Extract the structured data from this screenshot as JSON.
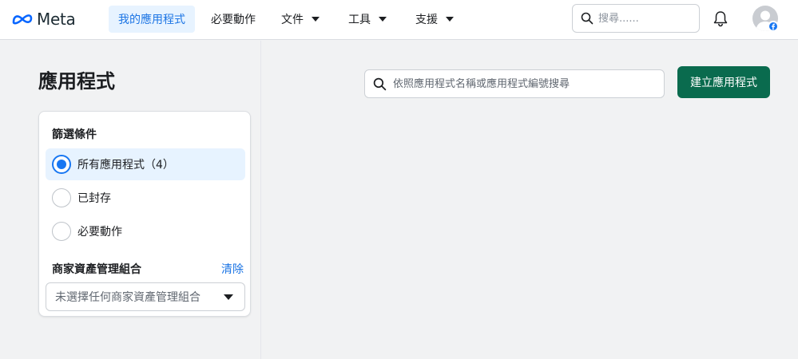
{
  "brand": {
    "name": "Meta",
    "color": "#0866ff"
  },
  "nav": {
    "items": [
      {
        "label": "我的應用程式",
        "active": true,
        "dropdown": false
      },
      {
        "label": "必要動作",
        "active": false,
        "dropdown": false
      },
      {
        "label": "文件",
        "active": false,
        "dropdown": true
      },
      {
        "label": "工具",
        "active": false,
        "dropdown": true
      },
      {
        "label": "支援",
        "active": false,
        "dropdown": true
      }
    ],
    "search_placeholder": "搜尋......",
    "icons": {
      "search": "search-icon",
      "notifications": "bell-icon",
      "profile": "avatar-icon",
      "badge": "facebook-icon"
    }
  },
  "page": {
    "title": "應用程式",
    "search_placeholder": "依照應用程式名稱或應用程式編號搜尋",
    "create_button": "建立應用程式",
    "accent_color": "#0a6b4e"
  },
  "filters": {
    "heading": "篩選條件",
    "options": [
      {
        "label": "所有應用程式（4）",
        "selected": true
      },
      {
        "label": "已封存",
        "selected": false
      },
      {
        "label": "必要動作",
        "selected": false
      }
    ],
    "business_portfolio": {
      "label": "商家資產管理組合",
      "clear_label": "清除",
      "select_placeholder": "未選擇任何商家資產管理組合"
    }
  }
}
